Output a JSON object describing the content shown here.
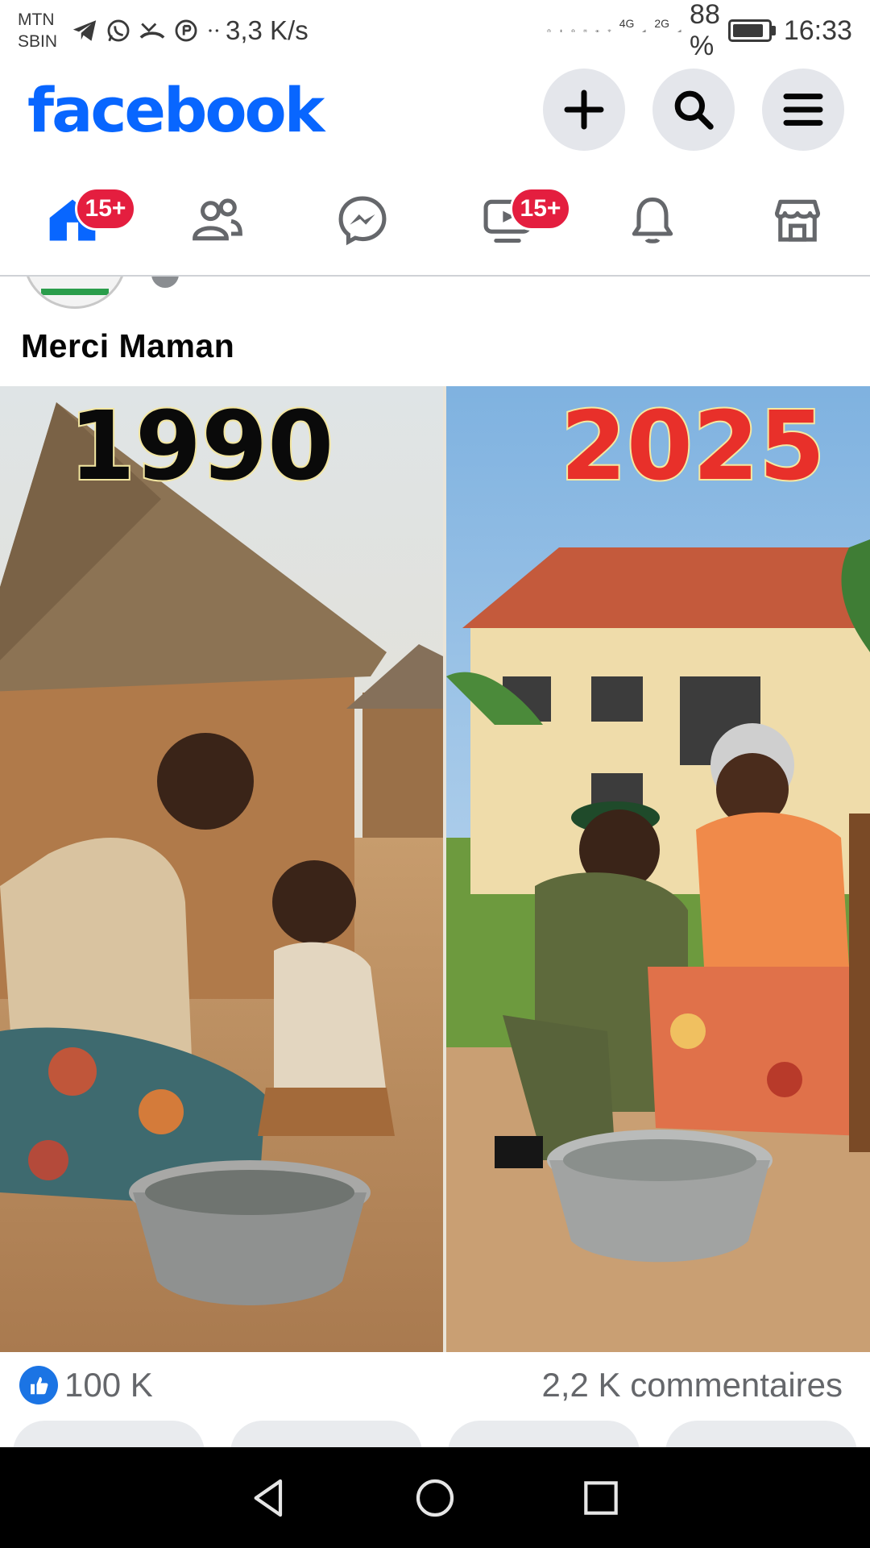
{
  "status_bar": {
    "carrier_line1": "MTN",
    "carrier_line2": "SBIN",
    "speed": "3,3 K/s",
    "network_4g": "4G",
    "network_2g": "2G",
    "battery": "88 %",
    "time": "16:33"
  },
  "header": {
    "logo": "facebook",
    "actions": [
      "plus-icon",
      "search-icon",
      "menu-icon"
    ]
  },
  "tabs": [
    {
      "icon": "home-icon",
      "badge": "15+",
      "active": true
    },
    {
      "icon": "friends-icon",
      "badge": ""
    },
    {
      "icon": "messenger-icon",
      "badge": ""
    },
    {
      "icon": "video-icon",
      "badge": "15+"
    },
    {
      "icon": "bell-icon",
      "badge": ""
    },
    {
      "icon": "marketplace-icon",
      "badge": ""
    }
  ],
  "post": {
    "caption": "Merci Maman",
    "image": {
      "left_year": "1990",
      "right_year": "2025"
    },
    "likes": "100 K",
    "comments": "2,2 K commentaires"
  },
  "colors": {
    "brand": "#0866ff",
    "badge": "#e41e3f",
    "like": "#1b74e4"
  }
}
